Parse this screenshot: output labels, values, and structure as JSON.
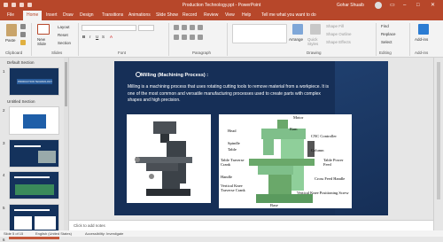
{
  "app": {
    "doc_title": "Production Technology.ppt - PowerPoint",
    "user": "Gohar Shuaib"
  },
  "tabs": [
    "File",
    "Home",
    "Insert",
    "Draw",
    "Design",
    "Transitions",
    "Animations",
    "Slide Show",
    "Record",
    "Review",
    "View",
    "Help",
    "Tell me what you want to do"
  ],
  "ribbon": {
    "paste": "Paste",
    "clipboard": "Clipboard",
    "new_slide": "New Slide",
    "layout": "Layout",
    "reset": "Reset",
    "section": "Section",
    "slides": "Slides",
    "font": "Font",
    "paragraph": "Paragraph",
    "drawing": "Drawing",
    "arrange": "Arrange",
    "quick_styles": "Quick Styles",
    "shape_fill": "Shape Fill",
    "shape_outline": "Shape Outline",
    "shape_effects": "Shape Effects",
    "find": "Find",
    "replace": "Replace",
    "select": "Select",
    "editing": "Editing",
    "addins": "Add-ins",
    "addins_group": "Add-ins"
  },
  "thumbs": {
    "sections": [
      "Default Section",
      "Untitled Section"
    ],
    "numbers": [
      "1",
      "2",
      "3",
      "4",
      "5",
      "6"
    ],
    "thumb1_title": "PRODUCTION TECHNOLOGY"
  },
  "slide": {
    "title": "Milling (Machining Process) :",
    "body": "Milling is a machining process that uses rotating cutting tools to remove material from a workpiece. It is one of the most common and versatile manufacturing processes used to create parts with complex shapes and high precision.",
    "labels": {
      "motor": "Motor",
      "head": "Head",
      "ram": "Ram",
      "cnc": "CNC Controller",
      "spindle": "Spindle",
      "table": "Table",
      "column": "Column",
      "table_power_feed": "Table Power Feed",
      "table_traverse_crank": "Table Traverse Crank",
      "handle": "Handle",
      "vertical_knee_traverse_crank": "Vertical Knee Traverse Crank",
      "cross_feed_handle": "Cross Feed Handle",
      "vertical_knee_positioning_screw": "Vertical Knee Positioning Screw",
      "base": "Base"
    }
  },
  "notes_placeholder": "Click to add notes",
  "status": {
    "slide": "Slide 5 of 15",
    "language": "English (United States)",
    "accessibility": "Accessibility: Investigate"
  }
}
